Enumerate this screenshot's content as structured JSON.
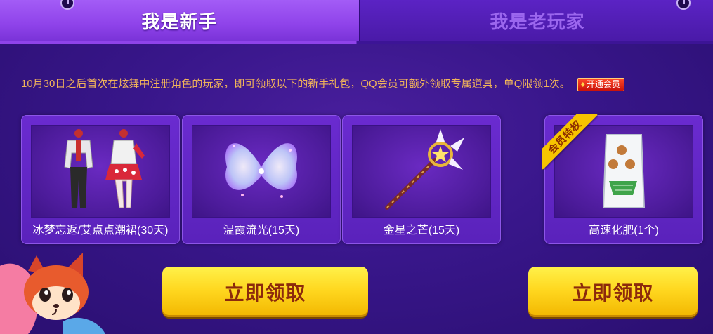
{
  "tabs": {
    "newbie": "我是新手",
    "veteran": "我是老玩家"
  },
  "notice": {
    "text": "10月30日之后首次在炫舞中注册角色的玩家，即可领取以下的新手礼包，QQ会员可额外领取专属道具，单Q限领1次。",
    "vip_button": "开通会员"
  },
  "items": [
    {
      "name": "冰梦忘返/艾点点潮裙(30天)",
      "icon": "outfit-icon"
    },
    {
      "name": "温霞流光(15天)",
      "icon": "wings-icon"
    },
    {
      "name": "金星之芒(15天)",
      "icon": "star-wand-icon"
    },
    {
      "name": "高速化肥(1个)",
      "icon": "fertilizer-bag-icon",
      "badge": "会员特权"
    }
  ],
  "buttons": {
    "claim_left": "立即领取",
    "claim_right": "立即领取"
  },
  "colors": {
    "accent": "#f7c400",
    "notice_text": "#f0b35a",
    "active_tab": "#8f43ea",
    "button_text": "#8c2a0c"
  }
}
